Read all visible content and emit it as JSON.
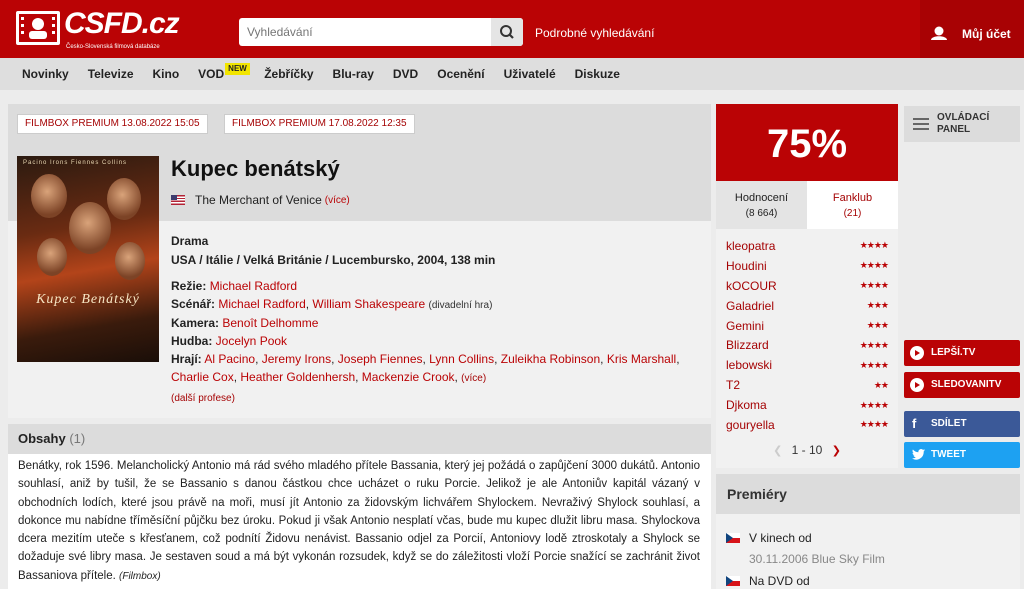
{
  "header": {
    "logo_text": "CSFD.cz",
    "logo_subtitle": "Česko-Slovenská filmová databáze",
    "search_placeholder": "Vyhledávání",
    "advanced_search": "Podrobné vyhledávání",
    "account": "Můj účet"
  },
  "nav": {
    "items": [
      "Novinky",
      "Televize",
      "Kino",
      "VOD",
      "Žebříčky",
      "Blu-ray",
      "DVD",
      "Ocenění",
      "Uživatelé",
      "Diskuze"
    ],
    "vod_badge": "NEW"
  },
  "tv_tags": [
    "FILMBOX PREMIUM 13.08.2022 15:05",
    "FILMBOX PREMIUM 17.08.2022 12:35"
  ],
  "film": {
    "title": "Kupec benátský",
    "original_title": "The Merchant of Venice",
    "more_link": "(více)",
    "genre": "Drama",
    "origin": "USA / Itálie / Velká Británie / Lucembursko, 2004, 138 min",
    "poster_title": "Kupec Benátský",
    "poster_names": "Pacino   Irons   Fiennes   Collins",
    "director_label": "Režie:",
    "director": "Michael Radford",
    "writer_label": "Scénář:",
    "writers": [
      "Michael Radford",
      "William Shakespeare"
    ],
    "writer_note": "(divadelní hra)",
    "camera_label": "Kamera:",
    "camera": "Benoît Delhomme",
    "music_label": "Hudba:",
    "music": "Jocelyn Pook",
    "cast_label": "Hrají:",
    "cast": [
      "Al Pacino",
      "Jeremy Irons",
      "Joseph Fiennes",
      "Lynn Collins",
      "Zuleikha Robinson",
      "Kris Marshall",
      "Charlie Cox",
      "Heather Goldenhersh",
      "Mackenzie Crook"
    ],
    "cast_more": "(více)",
    "more_professions": "(další profese)"
  },
  "synopsis": {
    "heading": "Obsahy",
    "count": "(1)",
    "text": "Benátky, rok 1596. Melancholický Antonio má rád svého mladého přítele Bassania, který jej požádá o zapůjčení 3000 dukátů. Antonio souhlasí, aniž by tušil, že se Bassanio s danou částkou chce ucházet o ruku Porcie. Jelikož je ale Antoniův kapitál vázaný v obchodních lodích, které jsou právě na moři, musí jít Antonio za židovským lichvářem Shylockem. Nevraživý Shylock souhlasí, a dokonce mu nabídne tříměsíční půjčku bez úroku. Pokud ji však Antonio nesplatí včas, bude mu kupec dlužit libru masa. Shylockova dcera mezitím uteče s křesťanem, což podnítí Židovu nenávist. Bassanio odjel za Porcií, Antoniovy lodě ztroskotaly a Shylock se dožaduje své libry masa. Je sestaven soud a má být vykonán rozsudek, když se do záležitosti vloží Porcie snažící se zachránit život Bassaniova přítele.",
    "source": "(Filmbox)"
  },
  "rating": {
    "percent": "75%",
    "tab_ratings": "Hodnocení",
    "tab_ratings_count": "(8 664)",
    "tab_fanclub": "Fanklub",
    "tab_fanclub_count": "(21)",
    "users": [
      {
        "name": "kleopatra",
        "stars": "★★★★"
      },
      {
        "name": "Houdini",
        "stars": "★★★★"
      },
      {
        "name": "kOCOUR",
        "stars": "★★★★"
      },
      {
        "name": "Galadriel",
        "stars": "★★★"
      },
      {
        "name": "Gemini",
        "stars": "★★★"
      },
      {
        "name": "Blizzard",
        "stars": "★★★★"
      },
      {
        "name": "lebowski",
        "stars": "★★★★"
      },
      {
        "name": "T2",
        "stars": "★★"
      },
      {
        "name": "Djkoma",
        "stars": "★★★★"
      },
      {
        "name": "gouryella",
        "stars": "★★★★"
      }
    ],
    "pager": "1 - 10"
  },
  "side": {
    "control_panel": "OVLÁDACÍ PANEL",
    "lepsi_tv": "LEPŠÍ.TV",
    "sledovani_tv": "SLEDOVANITV",
    "share": "SDÍLET",
    "tweet": "TWEET"
  },
  "premieres": {
    "heading": "Premiéry",
    "cinema": "V kinech od",
    "cinema_date": "30.11.2006 Blue Sky Film",
    "dvd": "Na DVD od"
  }
}
